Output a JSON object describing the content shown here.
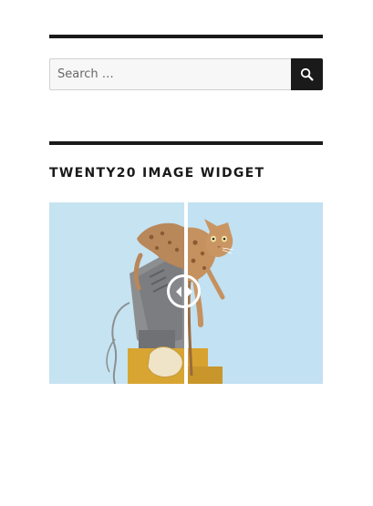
{
  "search": {
    "placeholder": "Search …",
    "value": "",
    "button_icon": "search-icon"
  },
  "widget": {
    "title": "TWENTY20 IMAGE WIDGET",
    "image_alt": "Cat hanging off a computer monitor",
    "handle_icons": [
      "arrow-left-icon",
      "arrow-right-icon"
    ]
  },
  "colors": {
    "rule": "#1a1a1a",
    "button": "#1a1a1a",
    "field_bg": "#f7f7f7",
    "image_bg": "#c4e2f1"
  }
}
